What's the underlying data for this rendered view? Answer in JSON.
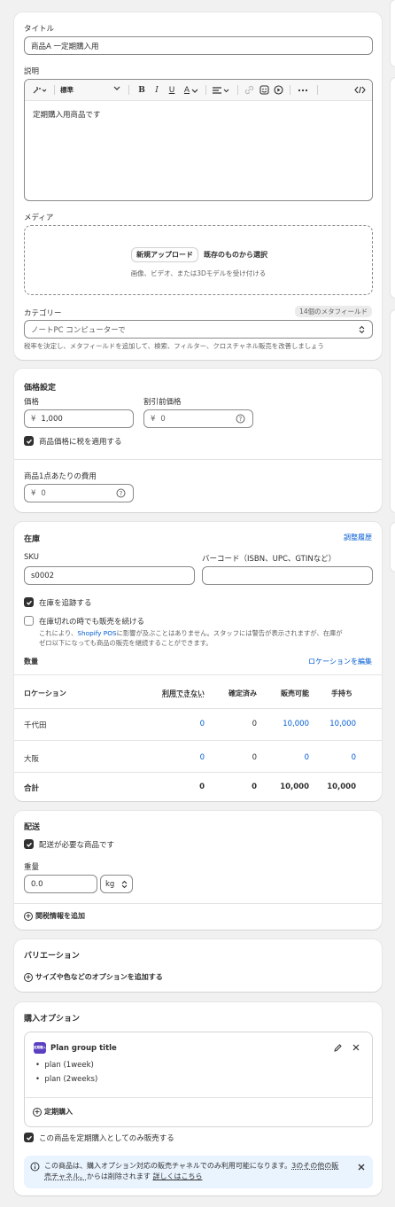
{
  "product": {
    "title_label": "タイトル",
    "title_value": "商品A 一定期購入用",
    "desc_label": "説明",
    "toolbar": {
      "format": "標準"
    },
    "desc_value": "定期購入用商品です",
    "media_label": "メディア",
    "upload_new": "新規アップロード",
    "select_existing": "既存のものから選択",
    "media_hint": "画像、ビデオ、または3Dモデルを受け付ける",
    "category_label": "カテゴリー",
    "metafield_badge": "14個のメタフィールド",
    "category_value": "ノートPC コンピューターで",
    "category_help": "税率を決定し、メタフィールドを追加して、検索、フィルター、クロスチャネル販売を改善しましょう"
  },
  "pricing": {
    "heading": "価格設定",
    "price_label": "価格",
    "price_prefix": "¥",
    "price_value": "1,000",
    "compare_label": "割引前価格",
    "compare_prefix": "¥",
    "compare_value": "0",
    "tax_label": "商品価格に税を適用する",
    "cost_label": "商品1点あたりの費用",
    "cost_prefix": "¥",
    "cost_value": "0"
  },
  "inventory": {
    "heading": "在庫",
    "history_link": "調整履歴",
    "sku_label": "SKU",
    "sku_value": "s0002",
    "barcode_label": "バーコード（ISBN、UPC、GTINなど）",
    "track_label": "在庫を追跡する",
    "continue_label": "在庫切れの時でも販売を続ける",
    "continue_help_1": "これにより、",
    "continue_help_link": "Shopify POS",
    "continue_help_2": "に影響が及ぶことはありません。スタッフには警告が表示されますが、在庫が",
    "continue_help_3": "ゼロ以下になっても商品の販売を継続することができます。",
    "quantity_label": "数量",
    "edit_locations": "ロケーションを編集",
    "columns": {
      "location": "ロケーション",
      "unavailable": "利用できない",
      "committed": "確定済み",
      "available": "販売可能",
      "on_hand": "手持ち"
    },
    "rows": [
      {
        "location": "千代田",
        "unavailable": "0",
        "committed": "0",
        "available": "10,000",
        "on_hand": "10,000"
      },
      {
        "location": "大阪",
        "unavailable": "0",
        "committed": "0",
        "available": "0",
        "on_hand": "0"
      }
    ],
    "total": {
      "location": "合計",
      "unavailable": "0",
      "committed": "0",
      "available": "10,000",
      "on_hand": "10,000"
    }
  },
  "shipping": {
    "heading": "配送",
    "physical_label": "配送が必要な商品です",
    "weight_label": "重量",
    "weight_value": "0.0",
    "unit": "kg",
    "customs_link": "関税情報を追加"
  },
  "variants": {
    "heading": "バリエーション",
    "add_options": "サイズや色などのオプションを追加する"
  },
  "purchase_options": {
    "heading": "購入オプション",
    "plan_icon_text": "定期購入",
    "plan_title": "Plan group title",
    "plans": [
      "plan (1week)",
      "plan (2weeks)"
    ],
    "add_subscription": "定期購入",
    "only_sub_label": "この商品を定期購入としてのみ販売する",
    "banner_1": "この商品は、購入オプション対応の販売チャネルでのみ利用可能になります。",
    "banner_link": "3のその他の販売チャネル。",
    "banner_2": "からは削除されます",
    "banner_more": "詳しくはこちら"
  },
  "colors": {
    "accent": "#005bd3",
    "banner_bg": "#eaf4ff",
    "check": "#303030",
    "plan_icon": "#5a3fc0"
  }
}
